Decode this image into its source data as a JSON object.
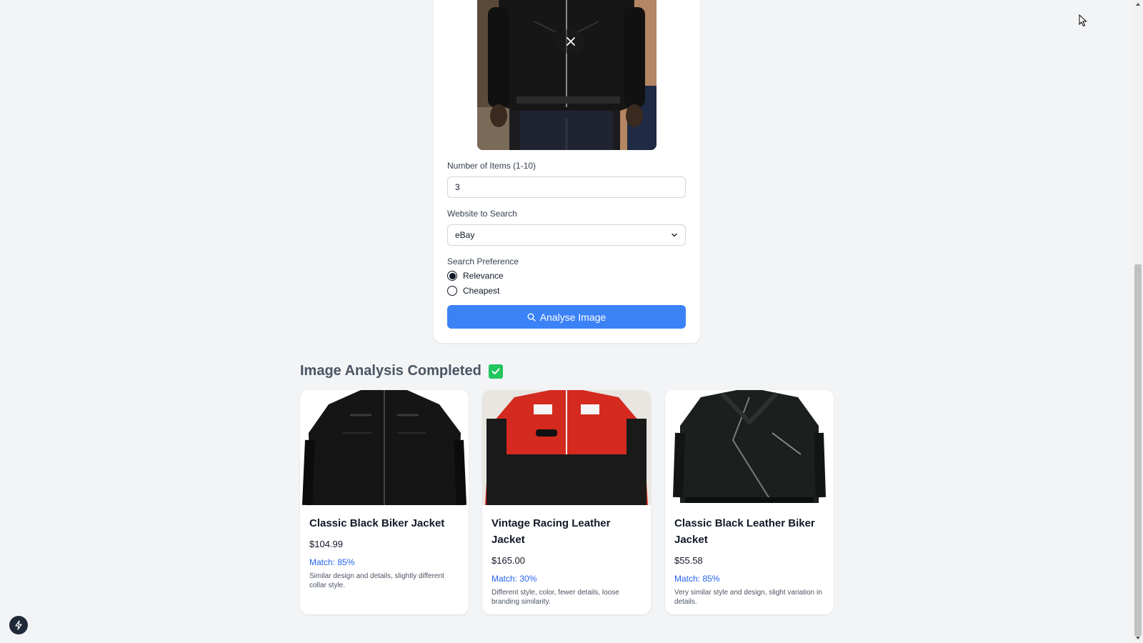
{
  "upload": {
    "close_icon": "close-icon",
    "preview_alt": "Uploaded image of person wearing black leather jacket"
  },
  "form": {
    "items_label": "Number of Items (1-10)",
    "items_value": "3",
    "website_label": "Website to Search",
    "website_value": "eBay",
    "preference_label": "Search Preference",
    "options": [
      {
        "label": "Relevance",
        "selected": true
      },
      {
        "label": "Cheapest",
        "selected": false
      }
    ],
    "analyse_label": "Analyse Image"
  },
  "results": {
    "heading": "Image Analysis Completed",
    "products": [
      {
        "title": "Classic Black Biker Jacket",
        "price": "$104.99",
        "match": "Match: 85%",
        "description": "Similar design and details, slightly different collar style."
      },
      {
        "title": "Vintage Racing Leather Jacket",
        "price": "$165.00",
        "match": "Match: 30%",
        "description": "Different style, color, fewer details, loose branding similarity."
      },
      {
        "title": "Classic Black Leather Biker Jacket",
        "price": "$55.58",
        "match": "Match: 85%",
        "description": "Very similar style and design, slight variation in details."
      }
    ]
  },
  "colors": {
    "accent": "#3b82f6",
    "match_text": "#2563eb",
    "success": "#22c55e",
    "background": "#f3f4f6"
  }
}
